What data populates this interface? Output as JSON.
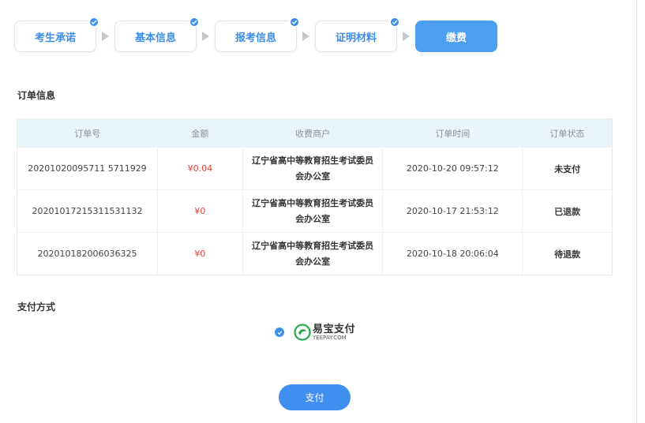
{
  "steps": [
    {
      "label": "考生承诺",
      "done": true
    },
    {
      "label": "基本信息",
      "done": true
    },
    {
      "label": "报考信息",
      "done": true
    },
    {
      "label": "证明材料",
      "done": true
    },
    {
      "label": "缴费",
      "active": true
    }
  ],
  "order_section": {
    "title": "订单信息",
    "columns": [
      "订单号",
      "金额",
      "收费商户",
      "订单时间",
      "订单状态"
    ],
    "rows": [
      {
        "order_no": "20201020095711 5711929",
        "amount": "¥0.04",
        "merchant": "辽宁省高中等教育招生考试委员会办公室",
        "time": "2020-10-20 09:57:12",
        "status": "未支付"
      },
      {
        "order_no": "20201017215311531132",
        "amount": "¥0",
        "merchant": "辽宁省高中等教育招生考试委员会办公室",
        "time": "2020-10-17 21:53:12",
        "status": "已退款"
      },
      {
        "order_no": "202010182006036325",
        "amount": "¥0",
        "merchant": "辽宁省高中等教育招生考试委员会办公室",
        "time": "2020-10-18 20:06:04",
        "status": "待退款"
      }
    ]
  },
  "payment": {
    "title": "支付方式",
    "method_cn": "易宝支付",
    "method_en": "YEEPAY.COM",
    "button_label": "支付"
  },
  "colors": {
    "accent": "#3d8ee8",
    "amount": "#e8413c",
    "table_header": "#e9f4f8"
  }
}
